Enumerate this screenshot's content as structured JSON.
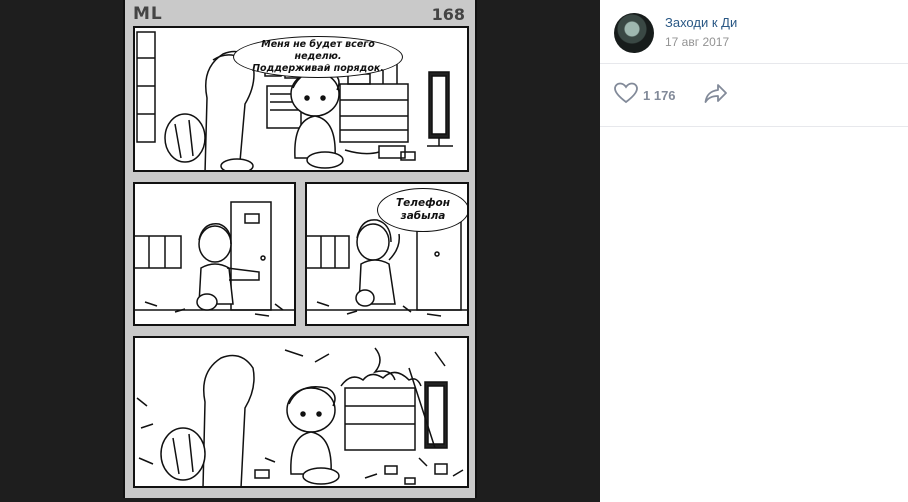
{
  "comic": {
    "corner_label": "ML",
    "page_number": "168",
    "panel1_speech": "Меня не будет всего неделю.\nПоддерживай порядок.",
    "panel3_speech": "Телефон\nзабыла"
  },
  "post": {
    "author": "Заходи к Ди",
    "date": "17 авг 2017",
    "likes": "1 176",
    "link_color": "#2a5885"
  },
  "icons": {
    "like": "heart-icon",
    "share": "share-arrow-icon"
  }
}
